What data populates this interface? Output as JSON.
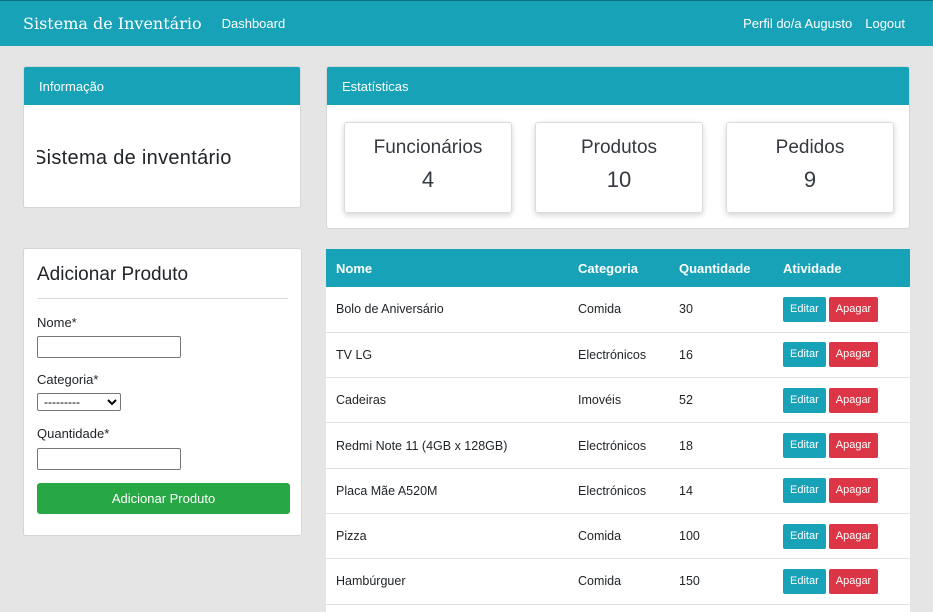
{
  "nav": {
    "brand": "Sistema de Inventário",
    "dashboard": "Dashboard",
    "profile": "Perfil do/a Augusto",
    "logout": "Logout"
  },
  "info": {
    "header": "Informação",
    "text": "Sistema de inventário"
  },
  "stats": {
    "header": "Estatísticas",
    "items": [
      {
        "label": "Funcionários",
        "value": "4"
      },
      {
        "label": "Produtos",
        "value": "10"
      },
      {
        "label": "Pedidos",
        "value": "9"
      }
    ]
  },
  "form": {
    "title": "Adicionar Produto",
    "name_label": "Nome*",
    "name_value": "",
    "category_label": "Categoria*",
    "category_selected": "---------",
    "quantity_label": "Quantidade*",
    "quantity_value": "",
    "submit": "Adicionar Produto"
  },
  "table": {
    "headers": [
      "Nome",
      "Categoria",
      "Quantidade",
      "Atividade"
    ],
    "edit_label": "Editar",
    "delete_label": "Apagar",
    "rows": [
      {
        "name": "Bolo de Aniversário",
        "category": "Comida",
        "quantity": "30"
      },
      {
        "name": "TV LG",
        "category": "Electrónicos",
        "quantity": "16"
      },
      {
        "name": "Cadeiras",
        "category": "Imovéis",
        "quantity": "52"
      },
      {
        "name": "Redmi Note 11 (4GB x 128GB)",
        "category": "Electrónicos",
        "quantity": "18"
      },
      {
        "name": "Placa Mãe A520M",
        "category": "Electrónicos",
        "quantity": "14"
      },
      {
        "name": "Pizza",
        "category": "Comida",
        "quantity": "100"
      },
      {
        "name": "Hambúrguer",
        "category": "Comida",
        "quantity": "150"
      }
    ]
  },
  "colors": {
    "primary": "#17a2b8",
    "success": "#28a745",
    "danger": "#dc3545",
    "background": "#e5e5e5"
  }
}
